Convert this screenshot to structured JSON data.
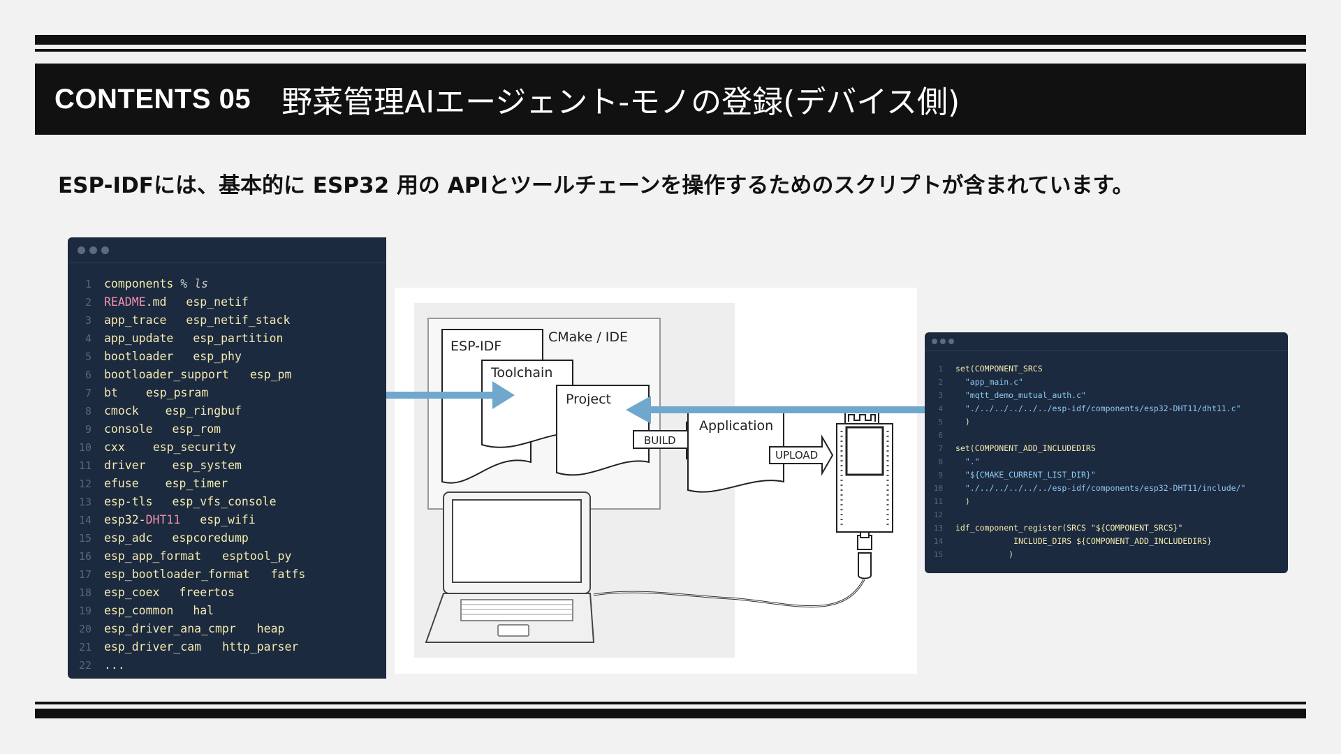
{
  "header": {
    "contents_label": "CONTENTS 05",
    "title": "野菜管理AIエージェント-モノの登録(デバイス側)"
  },
  "subtitle": "ESP-IDFには、基本的に ESP32 用の APIとツールチェーンを操作するためのスクリプトが含まれています。",
  "left_terminal": {
    "prompt_dir": "components",
    "prompt_symbol": "%",
    "prompt_cmd": "ls",
    "rows": [
      {
        "n": "1"
      },
      {
        "n": "2",
        "a": "README.md",
        "b": "esp_netif"
      },
      {
        "n": "3",
        "a": "app_trace",
        "b": "esp_netif_stack"
      },
      {
        "n": "4",
        "a": "app_update",
        "b": "esp_partition"
      },
      {
        "n": "5",
        "a": "bootloader",
        "b": "esp_phy"
      },
      {
        "n": "6",
        "a": "bootloader_support",
        "b": "esp_pm"
      },
      {
        "n": "7",
        "a": "bt",
        "b": "esp_psram"
      },
      {
        "n": "8",
        "a": "cmock",
        "b": "esp_ringbuf"
      },
      {
        "n": "9",
        "a": "console",
        "b": "esp_rom"
      },
      {
        "n": "10",
        "a": "cxx",
        "b": "esp_security"
      },
      {
        "n": "11",
        "a": "driver",
        "b": "esp_system"
      },
      {
        "n": "12",
        "a": "efuse",
        "b": "esp_timer"
      },
      {
        "n": "13",
        "a": "esp-tls",
        "b": "esp_vfs_console"
      },
      {
        "n": "14",
        "a": "esp32-DHT11",
        "b": "esp_wifi"
      },
      {
        "n": "15",
        "a": "esp_adc",
        "b": "espcoredump"
      },
      {
        "n": "16",
        "a": "esp_app_format",
        "b": "esptool_py"
      },
      {
        "n": "17",
        "a": "esp_bootloader_format",
        "b": "fatfs"
      },
      {
        "n": "18",
        "a": "esp_coex",
        "b": "freertos"
      },
      {
        "n": "19",
        "a": "esp_common",
        "b": "hal"
      },
      {
        "n": "20",
        "a": "esp_driver_ana_cmpr",
        "b": "heap"
      },
      {
        "n": "21",
        "a": "esp_driver_cam",
        "b": "http_parser"
      },
      {
        "n": "22",
        "a": "..."
      }
    ]
  },
  "right_code": {
    "lines": [
      {
        "n": "1",
        "t": "set(COMPONENT_SRCS"
      },
      {
        "n": "2",
        "t": "  \"app_main.c\""
      },
      {
        "n": "3",
        "t": "  \"mqtt_demo_mutual_auth.c\""
      },
      {
        "n": "4",
        "t": "  \"./../../../../../esp-idf/components/esp32-DHT11/dht11.c\""
      },
      {
        "n": "5",
        "t": "  )"
      },
      {
        "n": "6",
        "t": ""
      },
      {
        "n": "7",
        "t": "set(COMPONENT_ADD_INCLUDEDIRS"
      },
      {
        "n": "8",
        "t": "  \".\""
      },
      {
        "n": "9",
        "t": "  \"${CMAKE_CURRENT_LIST_DIR}\""
      },
      {
        "n": "10",
        "t": "  \"./../../../../../esp-idf/components/esp32-DHT11/include/\""
      },
      {
        "n": "11",
        "t": "  )"
      },
      {
        "n": "12",
        "t": ""
      },
      {
        "n": "13",
        "t": "idf_component_register(SRCS \"${COMPONENT_SRCS}\""
      },
      {
        "n": "14",
        "t": "            INCLUDE_DIRS ${COMPONENT_ADD_INCLUDEDIRS}"
      },
      {
        "n": "15",
        "t": "           )"
      }
    ]
  },
  "diagram": {
    "esp_idf": "ESP-IDF",
    "cmake_ide": "CMake / IDE",
    "toolchain": "Toolchain",
    "project": "Project",
    "build": "BUILD",
    "application": "Application",
    "upload": "UPLOAD"
  },
  "colors": {
    "header_bg": "#111111",
    "panel_bg": "#1b2a3e",
    "arrow": "#6fa8cc"
  }
}
